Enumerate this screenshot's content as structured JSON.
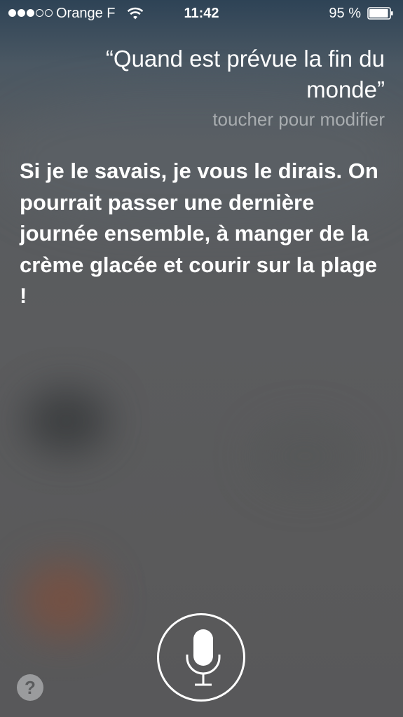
{
  "status_bar": {
    "carrier": "Orange F",
    "time": "11:42",
    "battery": "95 %",
    "signal_bars_filled": 3,
    "signal_bars_total": 5,
    "battery_level": 0.95
  },
  "siri": {
    "query": "“Quand est prévue la fin du monde”",
    "edit_hint": "toucher pour modifier",
    "answer": "Si je le savais, je vous le dirais. On pourrait passer une dernière journée ensemble, à manger de la crème glacée et courir sur la plage !"
  },
  "controls": {
    "mic_icon": "microphone-icon",
    "help_label": "?"
  },
  "colors": {
    "text": "#ffffff",
    "hint": "#a9adb0",
    "help_bg": "#9a9b9d"
  }
}
